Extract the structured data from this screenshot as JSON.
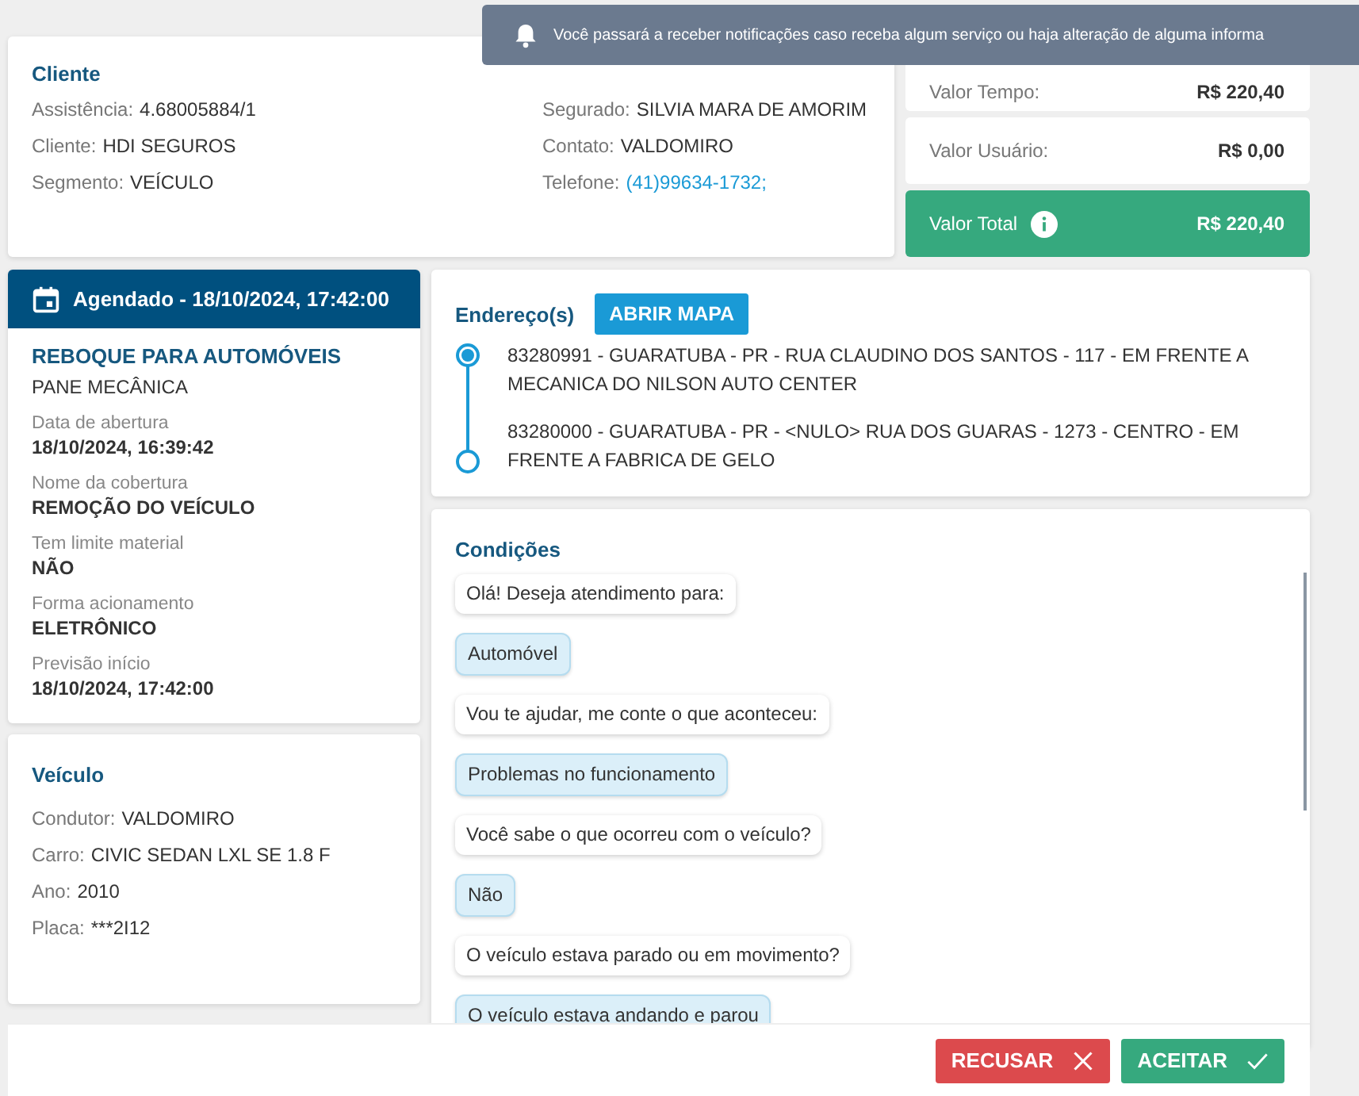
{
  "notification": {
    "text": "Você passará a receber notificações caso receba algum serviço ou haja alteração de alguma informa"
  },
  "client": {
    "title": "Cliente",
    "left": [
      {
        "label": "Assistência:",
        "value": "4.68005884/1",
        "kind": "text"
      },
      {
        "label": "Cliente:",
        "value": "HDI SEGUROS",
        "kind": "text"
      },
      {
        "label": "Segmento:",
        "value": "VEÍCULO",
        "kind": "text"
      }
    ],
    "right": [
      {
        "label": "Segurado:",
        "value": "SILVIA MARA DE AMORIM",
        "kind": "text"
      },
      {
        "label": "Contato:",
        "value": "VALDOMIRO",
        "kind": "text"
      },
      {
        "label": "Telefone:",
        "value": "(41)99634-1732;",
        "kind": "link"
      }
    ]
  },
  "values": [
    {
      "label": "Valor Tempo:",
      "value": "R$ 220,40",
      "kind": "normal"
    },
    {
      "label": "Valor Usuário:",
      "value": "R$ 0,00",
      "kind": "normal"
    },
    {
      "label": "Valor Total",
      "value": "R$ 220,40",
      "kind": "total"
    }
  ],
  "service": {
    "header": "Agendado - 18/10/2024, 17:42:00",
    "title": "REBOQUE PARA AUTOMÓVEIS",
    "subtitle": "PANE MECÂNICA",
    "fields": [
      {
        "label": "Data de abertura",
        "value": "18/10/2024, 16:39:42"
      },
      {
        "label": "Nome da cobertura",
        "value": "REMOÇÃO DO VEÍCULO"
      },
      {
        "label": "Tem limite material",
        "value": "NÃO"
      },
      {
        "label": "Forma acionamento",
        "value": "ELETRÔNICO"
      },
      {
        "label": "Previsão início",
        "value": "18/10/2024, 17:42:00"
      }
    ]
  },
  "vehicle": {
    "title": "Veículo",
    "fields": [
      {
        "label": "Condutor:",
        "value": "VALDOMIRO"
      },
      {
        "label": "Carro:",
        "value": "CIVIC SEDAN LXL SE 1.8 F"
      },
      {
        "label": "Ano:",
        "value": "2010"
      },
      {
        "label": "Placa:",
        "value": "***2I12"
      }
    ]
  },
  "addresses": {
    "title": "Endereço(s)",
    "button": "ABRIR MAPA",
    "items": [
      {
        "text": "83280991 - GUARATUBA - PR - RUA CLAUDINO DOS SANTOS - 117 - EM FRENTE A MECANICA DO NILSON AUTO CENTER",
        "kind": "origin"
      },
      {
        "text": "83280000 - GUARATUBA - PR - <NULO> RUA DOS GUARAS - 1273 - CENTRO - EM FRENTE A FABRICA DE GELO",
        "kind": "destination"
      }
    ]
  },
  "conditions": {
    "title": "Condições",
    "messages": [
      {
        "text": "Olá! Deseja atendimento para:",
        "kind": "question"
      },
      {
        "text": "Automóvel",
        "kind": "answer"
      },
      {
        "text": "Vou te ajudar, me conte o que aconteceu:",
        "kind": "question"
      },
      {
        "text": "Problemas no funcionamento",
        "kind": "answer"
      },
      {
        "text": "Você sabe o que ocorreu com o veículo?",
        "kind": "question"
      },
      {
        "text": "Não",
        "kind": "answer"
      },
      {
        "text": "O veículo estava parado ou em movimento?",
        "kind": "question"
      },
      {
        "text": "O veículo estava andando e parou",
        "kind": "answer"
      }
    ]
  },
  "actions": [
    {
      "label": "RECUSAR",
      "kind": "reject"
    },
    {
      "label": "ACEITAR",
      "kind": "accept"
    }
  ]
}
